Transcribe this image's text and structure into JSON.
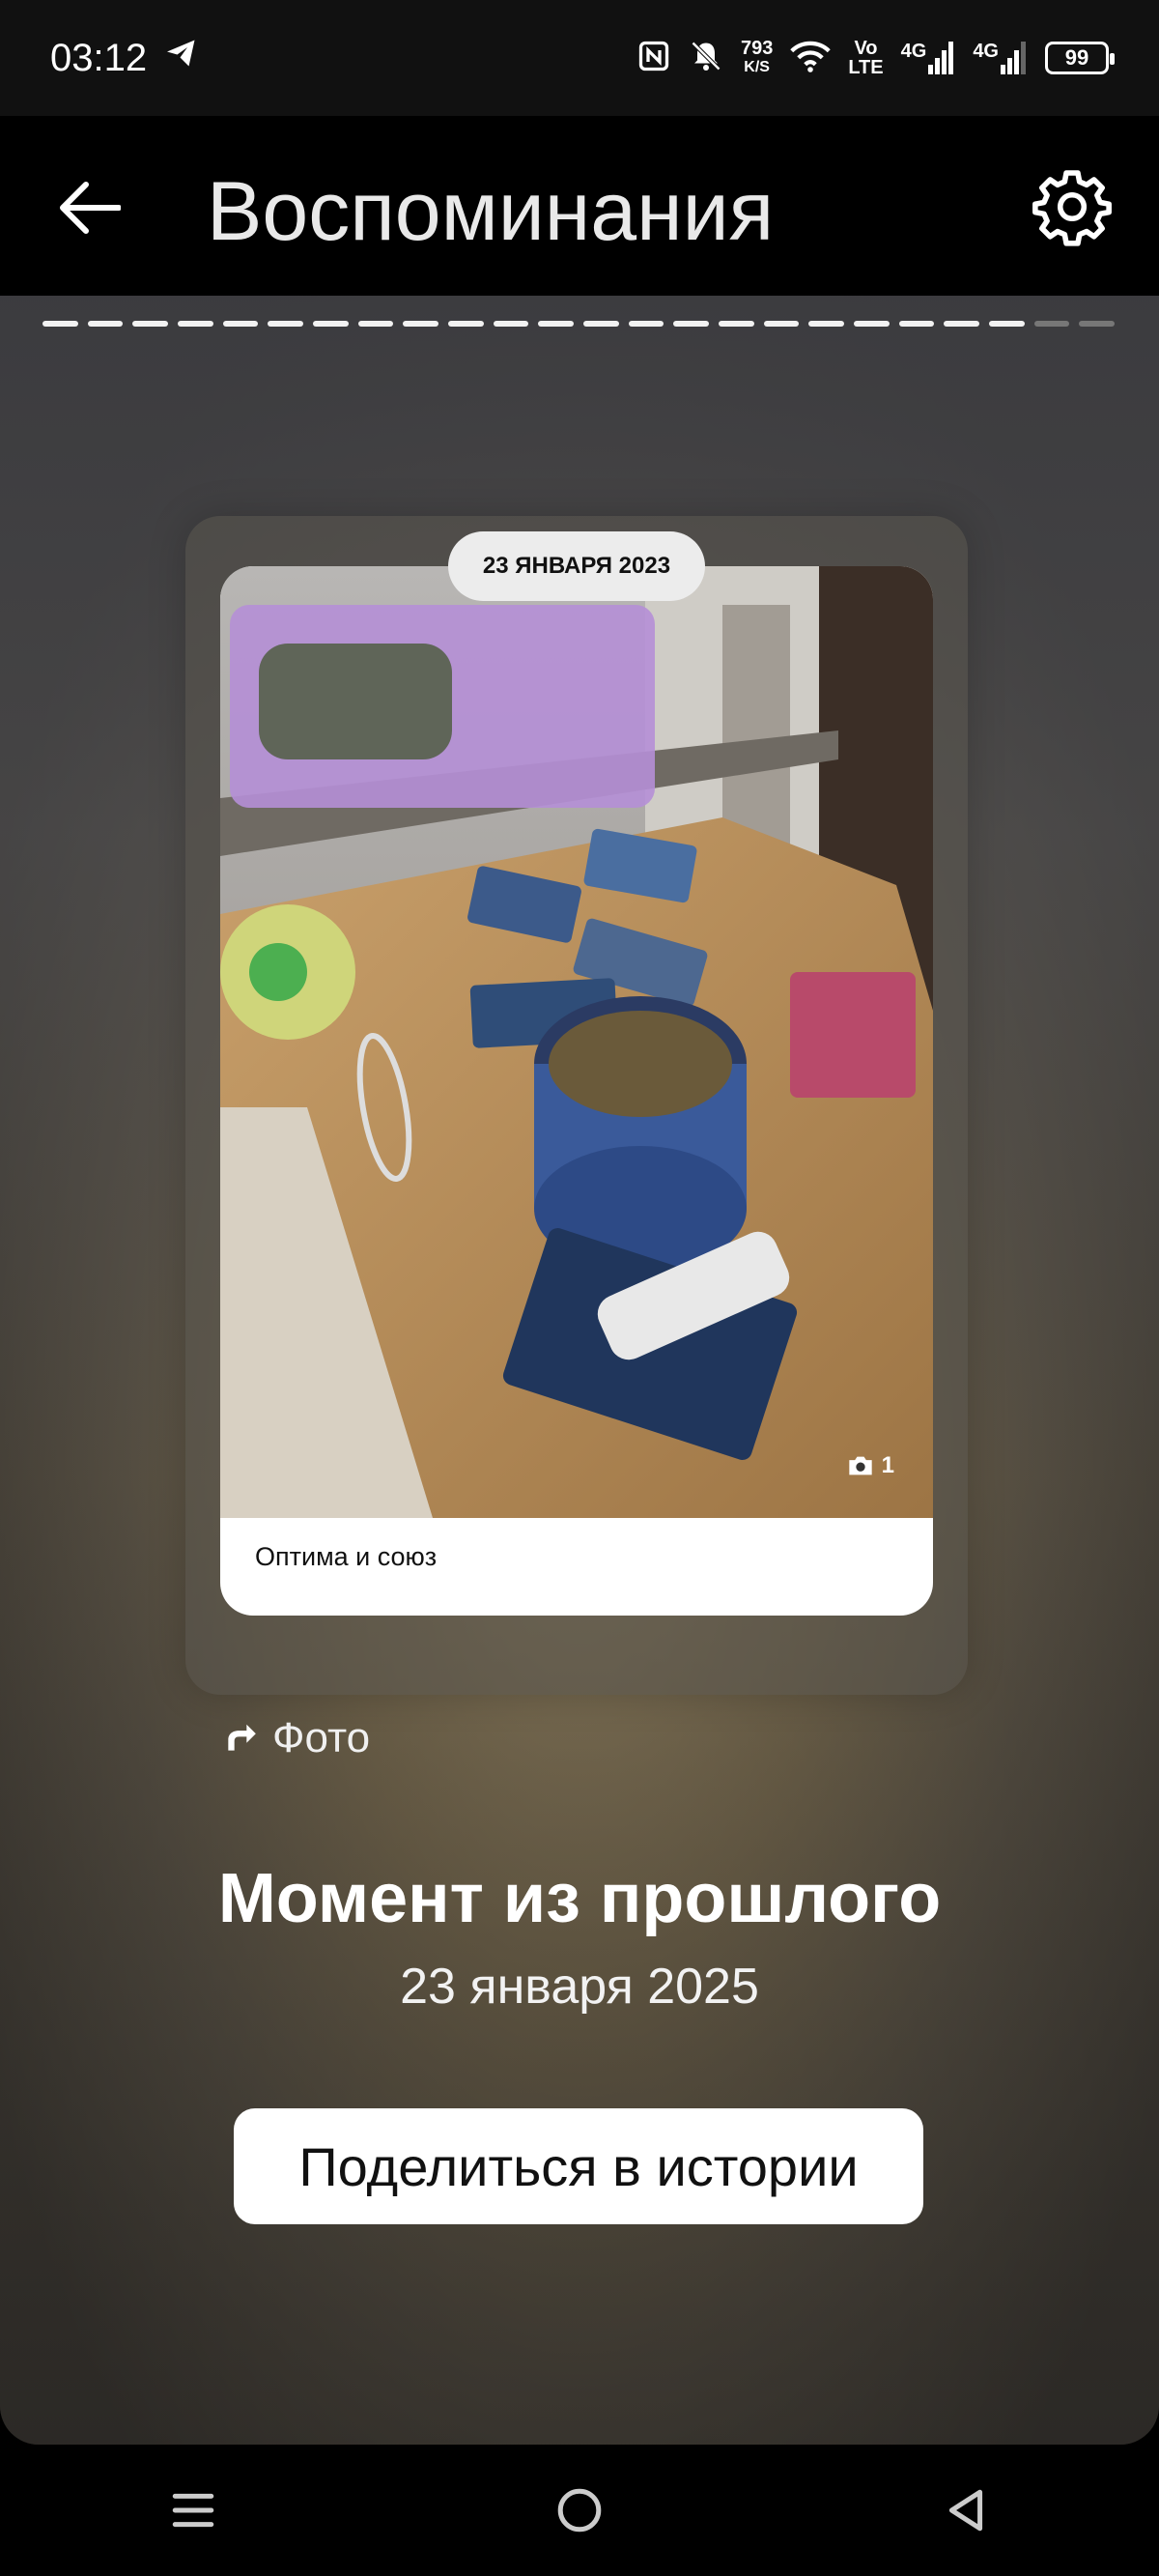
{
  "status_bar": {
    "time": "03:12",
    "net_speed_value": "793",
    "net_speed_unit": "K/S",
    "volte_top": "Vo",
    "volte_bottom": "LTE",
    "sim1_type": "4G",
    "sim2_type": "4G",
    "battery": "99"
  },
  "header": {
    "title": "Воспоминания"
  },
  "story": {
    "segments_total": 24,
    "segments_viewed": 22,
    "card": {
      "date": "23 ЯНВАРЯ 2023",
      "photo_count": "1",
      "caption": "Оптима и союз"
    },
    "type_label": "Фото",
    "title": "Момент из прошлого",
    "date": "23 января 2025",
    "share_button": "Поделиться в истории"
  },
  "icons": {
    "back": "arrow-left-icon",
    "settings": "gear-icon",
    "camera": "camera-icon",
    "repost": "repost-arrow-icon"
  }
}
